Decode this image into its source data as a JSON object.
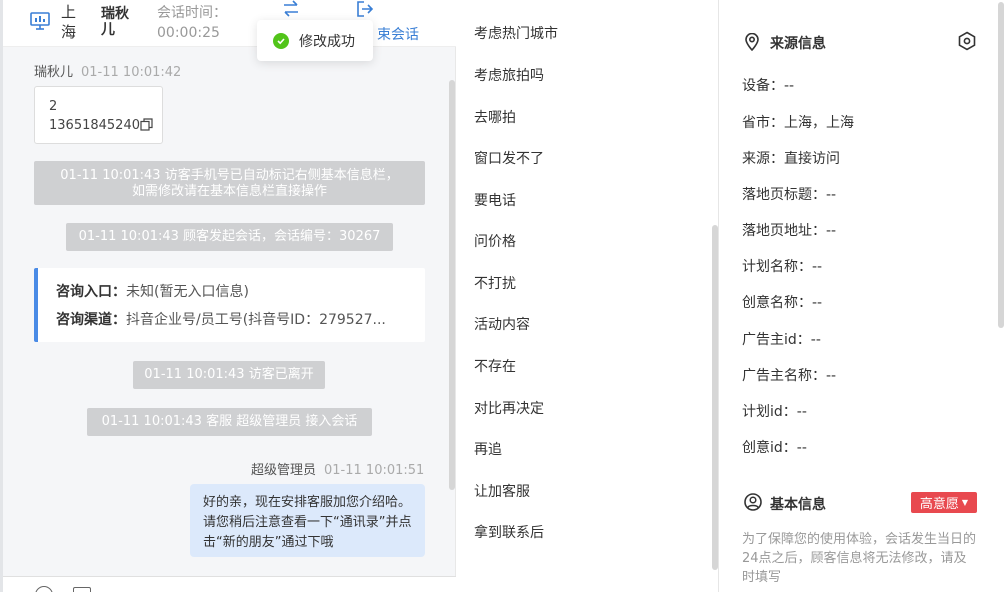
{
  "header": {
    "city": "上海",
    "visitor_name": "瑞秋儿",
    "session_time_label": "会话时间：",
    "session_time": "00:00:25",
    "end_session_label": "束会话"
  },
  "toast": {
    "text": "修改成功"
  },
  "chat": {
    "visitor_msg": {
      "name": "瑞秋儿",
      "time": "01-11 10:01:42",
      "line1": "2",
      "line2": "13651845240"
    },
    "system_messages": [
      "01-11 10:01:43 访客手机号已自动标记右侧基本信息栏，如需修改请在基本信息栏直接操作",
      "01-11 10:01:43 顾客发起会话，会话编号：30267",
      "01-11 10:01:43 访客已离开",
      "01-11 10:01:43 客服 超级管理员 接入会话"
    ],
    "source": {
      "entry_label": "咨询入口：",
      "entry_value": "未知(暂无入口信息)",
      "channel_label": "咨询渠道：",
      "channel_value": "抖音企业号/员工号(抖音号ID：279527..."
    },
    "agent_msg": {
      "name": "超级管理员",
      "time": "01-11 10:01:51",
      "text": "好的亲，现在安排客服加您介绍哈。请您稍后注意查看一下“通讯录”并点击“新的朋友”通过下哦"
    }
  },
  "quick_replies": [
    "考虑热门城市",
    "考虑旅拍吗",
    "去哪拍",
    "窗口发不了",
    "要电话",
    "问价格",
    "不打扰",
    "活动内容",
    "不存在",
    "对比再决定",
    "再追",
    "让加客服",
    "拿到联系后"
  ],
  "source_info": {
    "title": "来源信息",
    "rows": [
      "设备：--",
      "省市：上海，上海",
      "来源：直接访问",
      "落地页标题：--",
      "落地页地址：--",
      "计划名称：--",
      "创意名称：--",
      "广告主id：--",
      "广告主名称：--",
      "计划id：--",
      "创意id：--"
    ]
  },
  "basic_info": {
    "title": "基本信息",
    "intent_label": "高意愿",
    "notice": "为了保障您的使用体验，会话发生当日的24点之后，顾客信息将无法修改，请及时填写"
  },
  "colors": {
    "accent": "#3a7fd5",
    "success": "#52c41a",
    "danger": "#e8494f",
    "agent_bubble": "#dce9fb",
    "system_bg": "#cfd0d2"
  }
}
